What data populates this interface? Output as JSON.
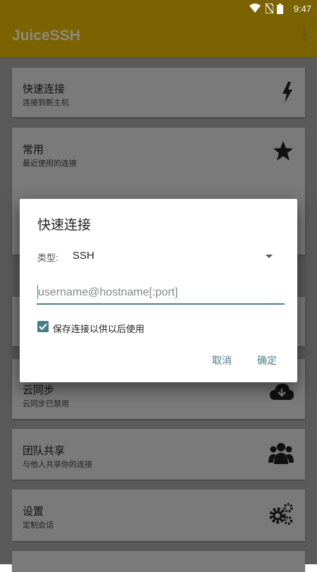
{
  "status_bar": {
    "time": "9:47"
  },
  "app_bar": {
    "title": "JuiceSSH"
  },
  "menu_cards": [
    {
      "title": "快速连接",
      "subtitle": "连接到新主机",
      "icon": "lightning-icon"
    },
    {
      "title": "常用",
      "subtitle": "最近使用的连接",
      "icon": "star-icon"
    },
    {
      "title": "云同步",
      "subtitle": "云同步已禁用",
      "icon": "cloud-download-icon"
    },
    {
      "title": "团队共享",
      "subtitle": "与他人共享你的连接",
      "icon": "team-icon"
    },
    {
      "title": "设置",
      "subtitle": "定制会话",
      "icon": "gears-icon"
    }
  ],
  "dialog": {
    "title": "快速连接",
    "type_label": "类型:",
    "type_value": "SSH",
    "address_placeholder": "username@hostname[:port]",
    "address_value": "",
    "save_checked": true,
    "save_label": "保存连接以供以后使用",
    "cancel_label": "取消",
    "ok_label": "确定"
  },
  "colors": {
    "app_bar": "#7a6300",
    "accent": "#4a7e86",
    "card_dimmed": "#7a7a7a",
    "background_dimmed": "#5a5a5a"
  }
}
